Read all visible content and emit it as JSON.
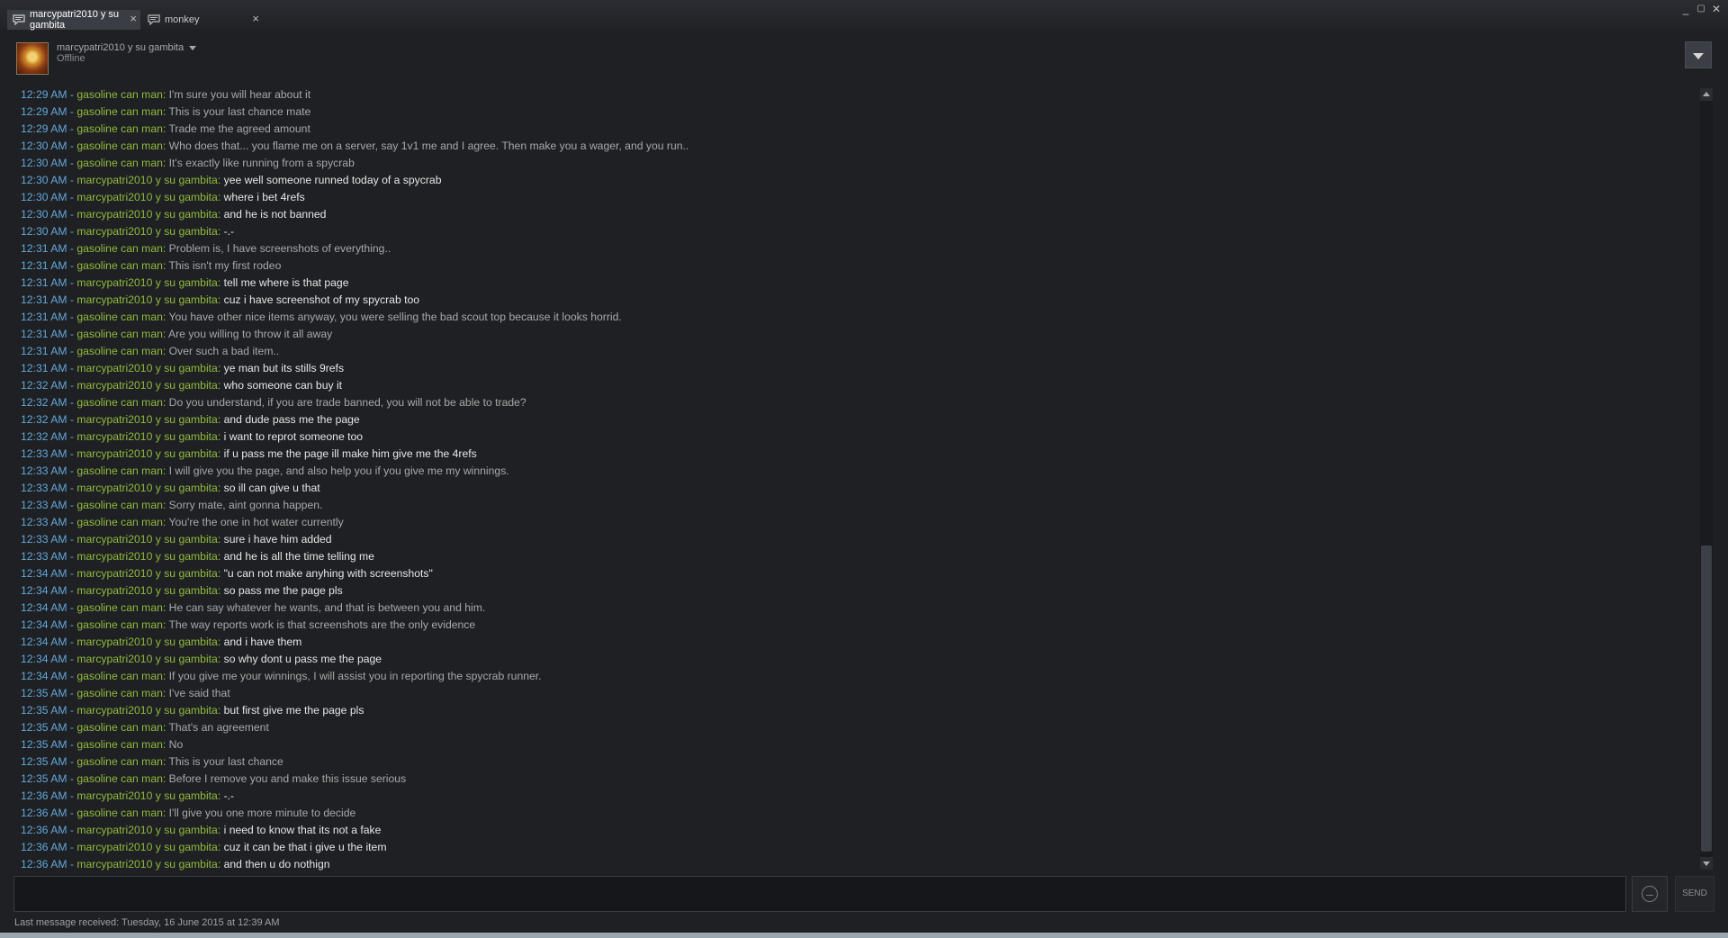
{
  "tabs": [
    {
      "label": "marcypatri2010 y su gambita",
      "close": "×"
    },
    {
      "label": "monkey",
      "close": "×"
    }
  ],
  "window_controls": {
    "minimize": "_",
    "maximize": "▢",
    "close": "✕"
  },
  "header": {
    "name": "marcypatri2010 y su gambita",
    "status": "Offline"
  },
  "messages": [
    {
      "time": "12:29 AM",
      "sender": "gasoline can man",
      "text": "I'm sure you will hear about it",
      "who": "gas"
    },
    {
      "time": "12:29 AM",
      "sender": "gasoline can man",
      "text": "This is your last chance mate",
      "who": "gas"
    },
    {
      "time": "12:29 AM",
      "sender": "gasoline can man",
      "text": "Trade me the agreed amount",
      "who": "gas"
    },
    {
      "time": "12:30 AM",
      "sender": "gasoline can man",
      "text": "Who does that... you flame me on a server, say 1v1 me and I agree. Then make you a wager, and you run..",
      "who": "gas"
    },
    {
      "time": "12:30 AM",
      "sender": "gasoline can man",
      "text": "It's exactly like running from a spycrab",
      "who": "gas"
    },
    {
      "time": "12:30 AM",
      "sender": "marcypatri2010 y su gambita",
      "text": "yee well someone runned today of a spycrab",
      "who": "marcy"
    },
    {
      "time": "12:30 AM",
      "sender": "marcypatri2010 y su gambita",
      "text": "where i bet 4refs",
      "who": "marcy"
    },
    {
      "time": "12:30 AM",
      "sender": "marcypatri2010 y su gambita",
      "text": "and he is not banned",
      "who": "marcy"
    },
    {
      "time": "12:30 AM",
      "sender": "marcypatri2010 y su gambita",
      "text": "-.-",
      "who": "marcy"
    },
    {
      "time": "12:31 AM",
      "sender": "gasoline can man",
      "text": "Problem is, I have screenshots of everything..",
      "who": "gas"
    },
    {
      "time": "12:31 AM",
      "sender": "gasoline can man",
      "text": "This isn't my first rodeo",
      "who": "gas"
    },
    {
      "time": "12:31 AM",
      "sender": "marcypatri2010 y su gambita",
      "text": "tell me where is that page",
      "who": "marcy"
    },
    {
      "time": "12:31 AM",
      "sender": "marcypatri2010 y su gambita",
      "text": "cuz i have screenshot of my spycrab too",
      "who": "marcy"
    },
    {
      "time": "12:31 AM",
      "sender": "gasoline can man",
      "text": "You have other nice items anyway, you were selling the bad scout top because it looks horrid.",
      "who": "gas"
    },
    {
      "time": "12:31 AM",
      "sender": "gasoline can man",
      "text": "Are you willing to throw it all away",
      "who": "gas"
    },
    {
      "time": "12:31 AM",
      "sender": "gasoline can man",
      "text": "Over such a bad item..",
      "who": "gas"
    },
    {
      "time": "12:31 AM",
      "sender": "marcypatri2010 y su gambita",
      "text": "ye man but its stills 9refs",
      "who": "marcy"
    },
    {
      "time": "12:32 AM",
      "sender": "marcypatri2010 y su gambita",
      "text": "who someone can buy it",
      "who": "marcy"
    },
    {
      "time": "12:32 AM",
      "sender": "gasoline can man",
      "text": "Do you understand, if you are trade banned, you will not be able to trade?",
      "who": "gas"
    },
    {
      "time": "12:32 AM",
      "sender": "marcypatri2010 y su gambita",
      "text": "and dude pass me the page",
      "who": "marcy"
    },
    {
      "time": "12:32 AM",
      "sender": "marcypatri2010 y su gambita",
      "text": "i want to reprot someone too",
      "who": "marcy"
    },
    {
      "time": "12:33 AM",
      "sender": "marcypatri2010 y su gambita",
      "text": "if u pass me the page ill make him give me the 4refs",
      "who": "marcy"
    },
    {
      "time": "12:33 AM",
      "sender": "gasoline can man",
      "text": "I will give you the page, and also help you if you give me my winnings.",
      "who": "gas"
    },
    {
      "time": "12:33 AM",
      "sender": "marcypatri2010 y su gambita",
      "text": "so ill can give u that",
      "who": "marcy"
    },
    {
      "time": "12:33 AM",
      "sender": "gasoline can man",
      "text": "Sorry mate, aint gonna happen.",
      "who": "gas"
    },
    {
      "time": "12:33 AM",
      "sender": "gasoline can man",
      "text": "You're the one in hot water currently",
      "who": "gas"
    },
    {
      "time": "12:33 AM",
      "sender": "marcypatri2010 y su gambita",
      "text": "sure i have him added",
      "who": "marcy"
    },
    {
      "time": "12:33 AM",
      "sender": "marcypatri2010 y su gambita",
      "text": "and he is all the time telling me",
      "who": "marcy"
    },
    {
      "time": "12:34 AM",
      "sender": "marcypatri2010 y su gambita",
      "text": "\"u can not make anyhing with screenshots\"",
      "who": "marcy"
    },
    {
      "time": "12:34 AM",
      "sender": "marcypatri2010 y su gambita",
      "text": "so pass me the page pls",
      "who": "marcy"
    },
    {
      "time": "12:34 AM",
      "sender": "gasoline can man",
      "text": "He can say whatever he wants, and that is between you and him.",
      "who": "gas"
    },
    {
      "time": "12:34 AM",
      "sender": "gasoline can man",
      "text": "The way reports work is that screenshots are the only evidence",
      "who": "gas"
    },
    {
      "time": "12:34 AM",
      "sender": "marcypatri2010 y su gambita",
      "text": "and i have them",
      "who": "marcy"
    },
    {
      "time": "12:34 AM",
      "sender": "marcypatri2010 y su gambita",
      "text": "so why dont u pass me the page",
      "who": "marcy"
    },
    {
      "time": "12:34 AM",
      "sender": "gasoline can man",
      "text": "If you give me your winnings, I will assist you in reporting the spycrab runner.",
      "who": "gas"
    },
    {
      "time": "12:35 AM",
      "sender": "gasoline can man",
      "text": "I've said that",
      "who": "gas"
    },
    {
      "time": "12:35 AM",
      "sender": "marcypatri2010 y su gambita",
      "text": "but first give me the page pls",
      "who": "marcy"
    },
    {
      "time": "12:35 AM",
      "sender": "gasoline can man",
      "text": "That's an agreement",
      "who": "gas"
    },
    {
      "time": "12:35 AM",
      "sender": "gasoline can man",
      "text": "No",
      "who": "gas"
    },
    {
      "time": "12:35 AM",
      "sender": "gasoline can man",
      "text": "This is your last chance",
      "who": "gas"
    },
    {
      "time": "12:35 AM",
      "sender": "gasoline can man",
      "text": "Before I remove you and make this issue serious",
      "who": "gas"
    },
    {
      "time": "12:36 AM",
      "sender": "marcypatri2010 y su gambita",
      "text": "-.-",
      "who": "marcy"
    },
    {
      "time": "12:36 AM",
      "sender": "gasoline can man",
      "text": "I'll give you one more minute to decide",
      "who": "gas"
    },
    {
      "time": "12:36 AM",
      "sender": "marcypatri2010 y su gambita",
      "text": "i need to know that its not a fake",
      "who": "marcy"
    },
    {
      "time": "12:36 AM",
      "sender": "marcypatri2010 y su gambita",
      "text": "cuz it can be that i give u the item",
      "who": "marcy"
    },
    {
      "time": "12:36 AM",
      "sender": "marcypatri2010 y su gambita",
      "text": "and then u do nothign",
      "who": "marcy"
    }
  ],
  "input": {
    "value": "",
    "send_label": "SEND"
  },
  "footer": {
    "last_received": "Last message received: Tuesday, 16 June 2015 at 12:39 AM"
  },
  "colors": {
    "timestamp": "#62a8d8",
    "sender": "#90ba3c",
    "background": "#1f2024"
  }
}
